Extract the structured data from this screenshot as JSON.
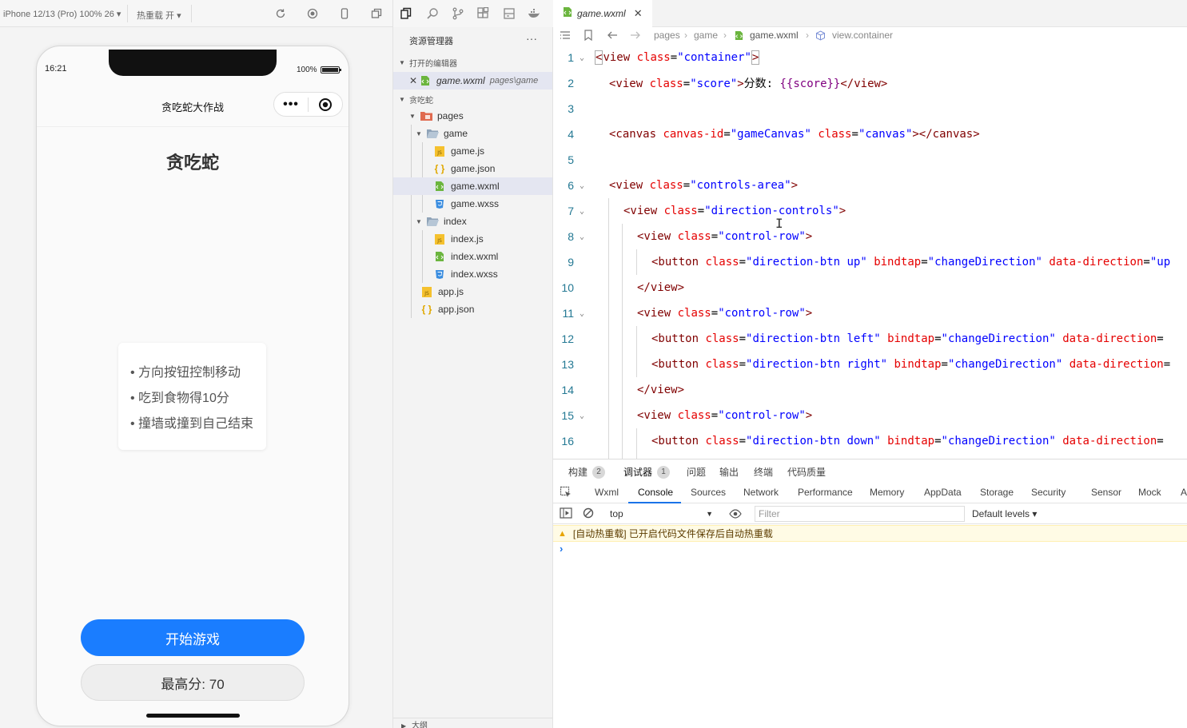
{
  "simulator": {
    "device_label": "iPhone 12/13 (Pro) 100% 26 ▾",
    "hot_reload_label": "热重载 开 ▾",
    "status_time": "16:21",
    "battery_text": "100%",
    "nav_title": "贪吃蛇大作战",
    "game_title": "贪吃蛇",
    "rules": [
      "• 方向按钮控制移动",
      "• 吃到食物得10分",
      "• 撞墙或撞到自己结束"
    ],
    "start_button": "开始游戏",
    "high_score": "最高分: 70"
  },
  "explorer": {
    "header": "资源管理器",
    "more": "···",
    "open_editors_label": "打开的编辑器",
    "open_file_name": "game.wxml",
    "open_file_path": "pages\\game",
    "project_label": "贪吃蛇",
    "tree": {
      "pages": "pages",
      "game": "game",
      "game_js": "game.js",
      "game_json": "game.json",
      "game_wxml": "game.wxml",
      "game_wxss": "game.wxss",
      "index": "index",
      "index_js": "index.js",
      "index_wxml": "index.wxml",
      "index_wxss": "index.wxss",
      "app_js": "app.js",
      "app_json": "app.json"
    },
    "outline_label": "大纲"
  },
  "editor": {
    "tab_name": "game.wxml",
    "tab_close": "✕",
    "breadcrumb": [
      "pages",
      "game",
      "game.wxml",
      "view.container"
    ],
    "line_numbers": [
      "1",
      "2",
      "3",
      "4",
      "5",
      "6",
      "7",
      "8",
      "9",
      "10",
      "11",
      "12",
      "13",
      "14",
      "15",
      "16"
    ]
  },
  "devtools": {
    "top_tabs": [
      {
        "label": "构建",
        "badge": "2"
      },
      {
        "label": "调试器",
        "badge": "1"
      },
      {
        "label": "问题"
      },
      {
        "label": "输出"
      },
      {
        "label": "终端"
      },
      {
        "label": "代码质量"
      }
    ],
    "panel_tabs": [
      "Wxml",
      "Console",
      "Sources",
      "Network",
      "Performance",
      "Memory",
      "AppData",
      "Storage",
      "Security",
      "Sensor",
      "Mock",
      "A"
    ],
    "context": "top",
    "filter_placeholder": "Filter",
    "levels": "Default levels ▾",
    "warning_text": "[自动热重载] 已开启代码文件保存后自动热重载",
    "prompt": "›"
  },
  "colors": {
    "accent": "#1a7dff",
    "tag": "#800000",
    "attr": "#e50000",
    "string": "#0000ff",
    "mustache": "#800080",
    "line_number": "#237893"
  }
}
